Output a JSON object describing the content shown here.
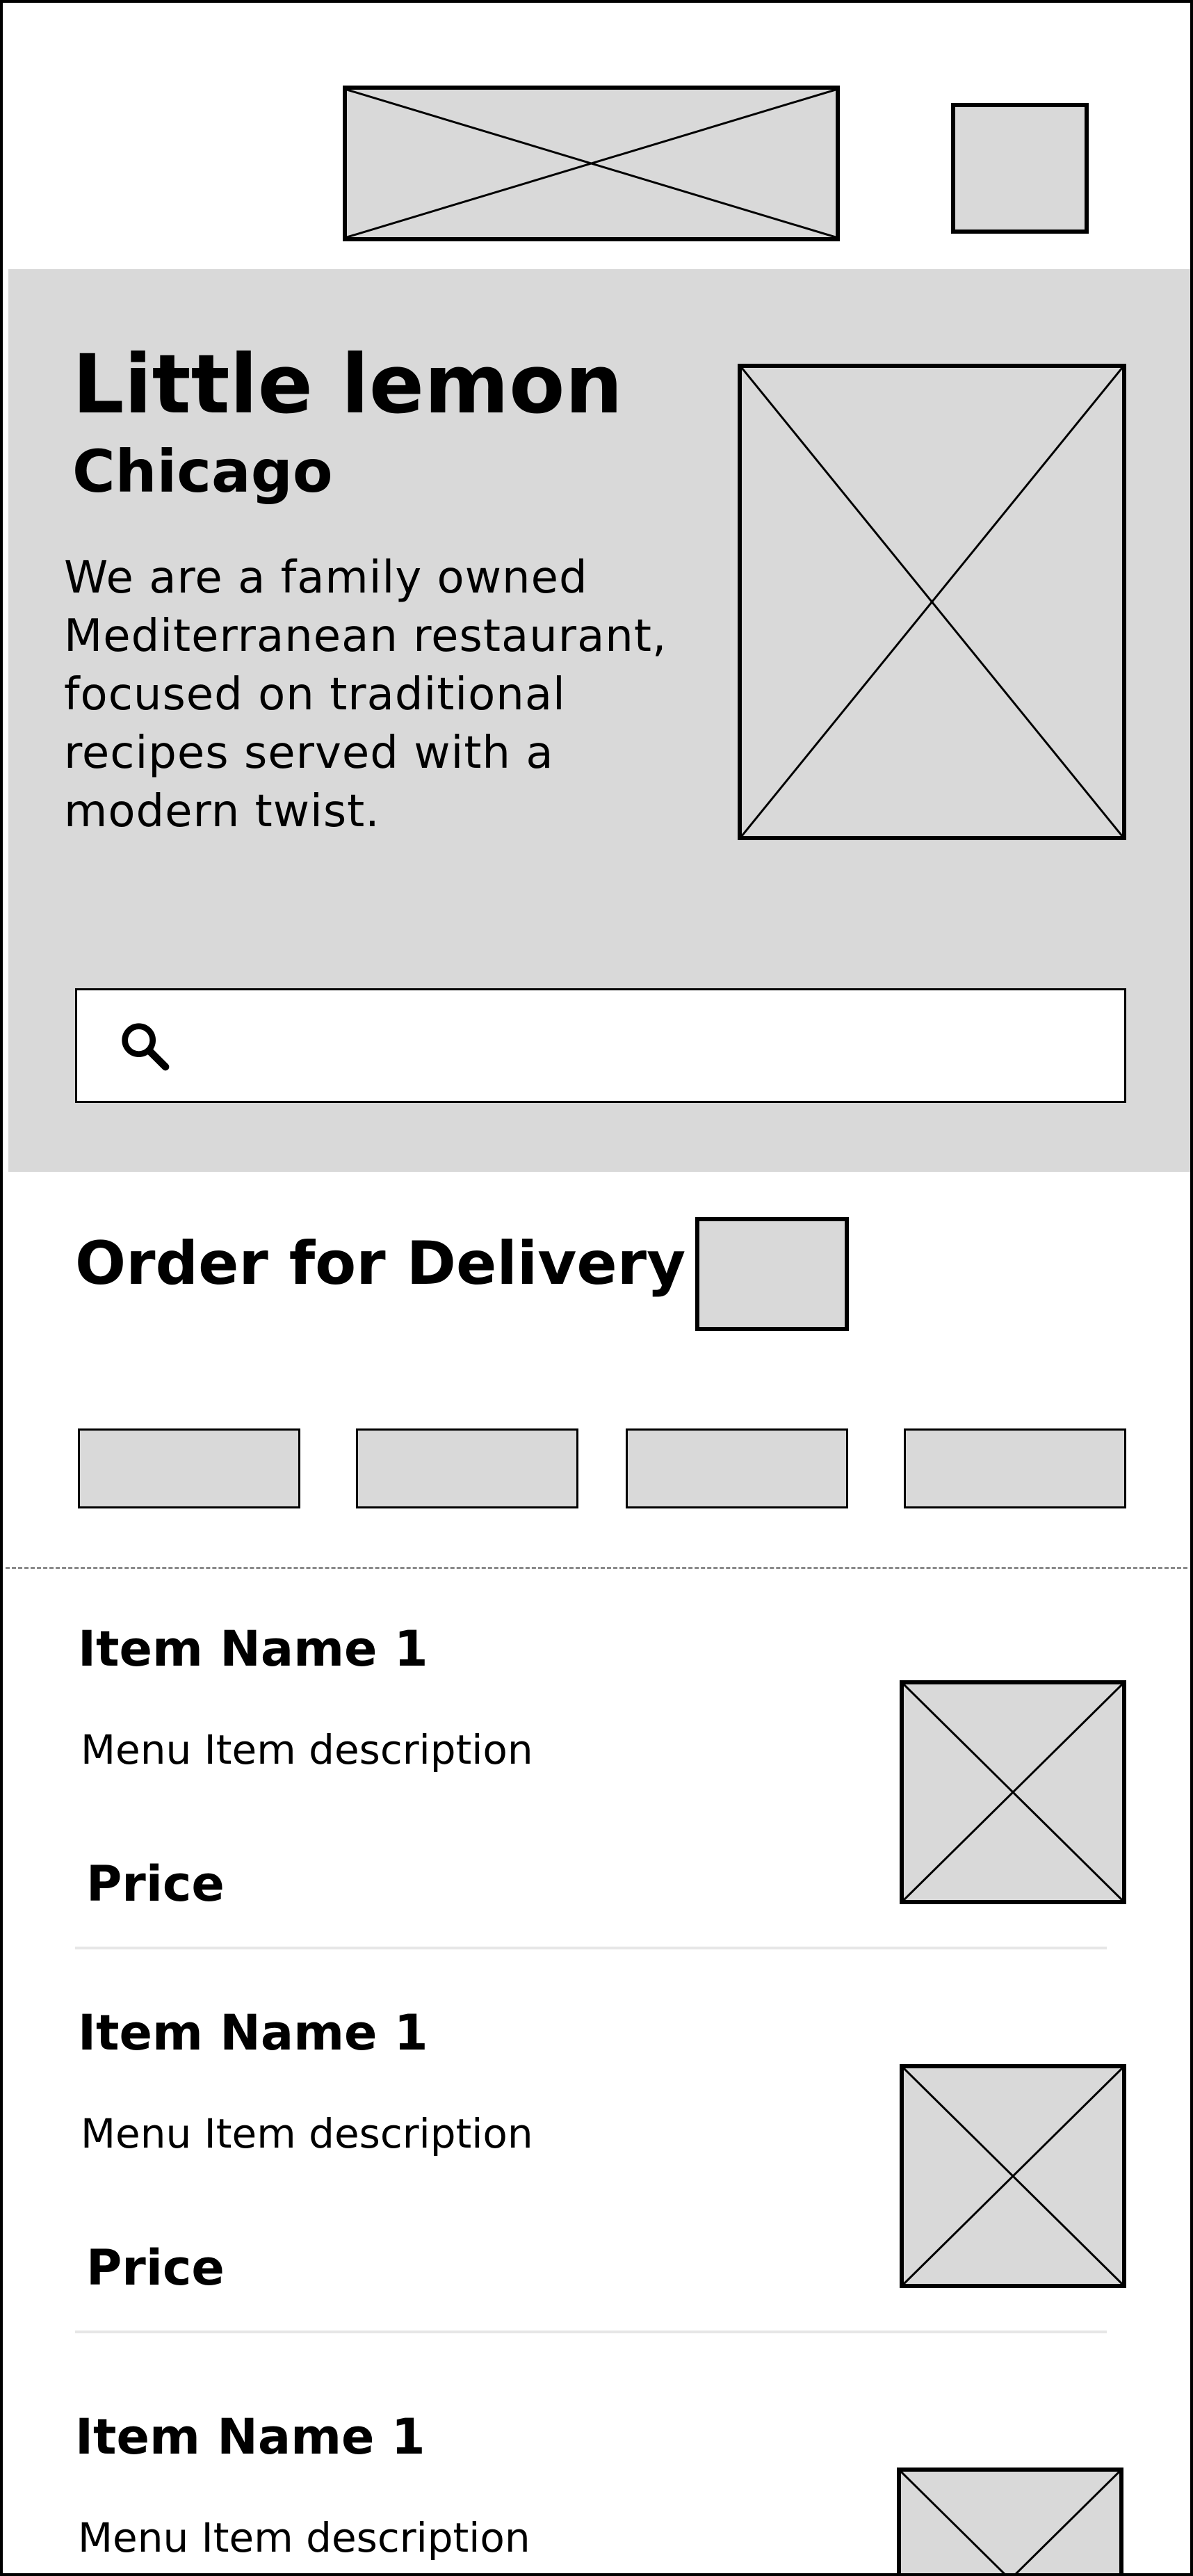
{
  "hero": {
    "title": "Little lemon",
    "subtitle": "Chicago",
    "description": "We are a family owned Mediterranean restaurant, focused on traditional recipes served with a modern twist."
  },
  "search": {
    "icon": "search-icon",
    "value": "",
    "placeholder": ""
  },
  "delivery": {
    "title": "Order for Delivery"
  },
  "menu": {
    "items": [
      {
        "name": "Item Name 1",
        "description": "Menu Item description",
        "price": "Price"
      },
      {
        "name": "Item Name 1",
        "description": "Menu Item description",
        "price": "Price"
      },
      {
        "name": "Item Name 1",
        "description": "Menu Item description"
      }
    ]
  },
  "colors": {
    "placeholder_fill": "#d9d9d9",
    "stroke": "#000000",
    "divider": "#e6e6e6",
    "background": "#ffffff"
  }
}
